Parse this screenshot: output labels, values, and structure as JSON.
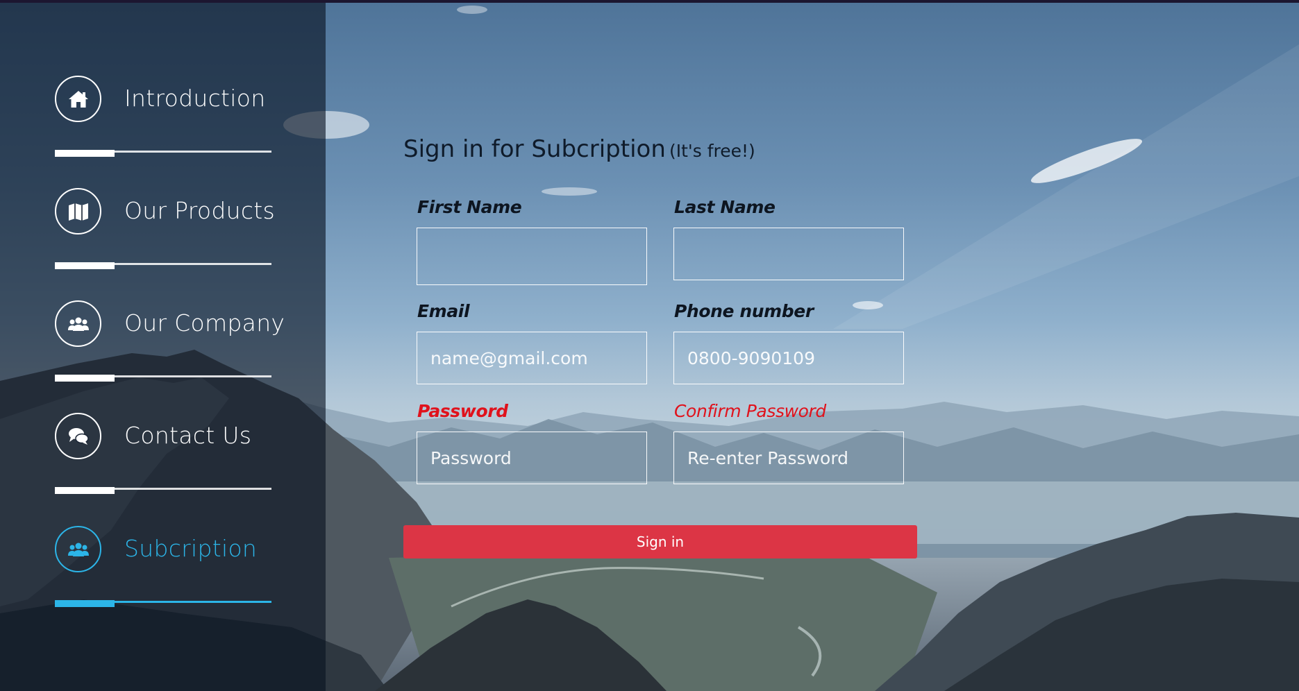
{
  "nav": {
    "items": [
      {
        "label": "Introduction",
        "icon": "home-icon"
      },
      {
        "label": "Our Products",
        "icon": "map-icon"
      },
      {
        "label": "Our Company",
        "icon": "users-icon"
      },
      {
        "label": "Contact Us",
        "icon": "chat-icon"
      },
      {
        "label": "Subcription",
        "icon": "users-icon",
        "active": true
      }
    ],
    "active_color": "#2cb5e8"
  },
  "form": {
    "title": "Sign in for Subcription",
    "subtitle": "(It's free!)",
    "fields": {
      "first_name": {
        "label": "First Name",
        "value": "",
        "placeholder": ""
      },
      "last_name": {
        "label": "Last Name",
        "value": "",
        "placeholder": ""
      },
      "email": {
        "label": "Email",
        "value": "",
        "placeholder": "name@gmail.com"
      },
      "phone": {
        "label": "Phone number",
        "value": "",
        "placeholder": "0800-9090109"
      },
      "password": {
        "label": "Password",
        "value": "",
        "placeholder": "Password"
      },
      "confirm_password": {
        "label": "Confirm Password",
        "value": "",
        "placeholder": "Re-enter Password"
      }
    },
    "submit_label": "Sign in",
    "submit_color": "#dc3545",
    "error_label_color": "#e0121c"
  }
}
